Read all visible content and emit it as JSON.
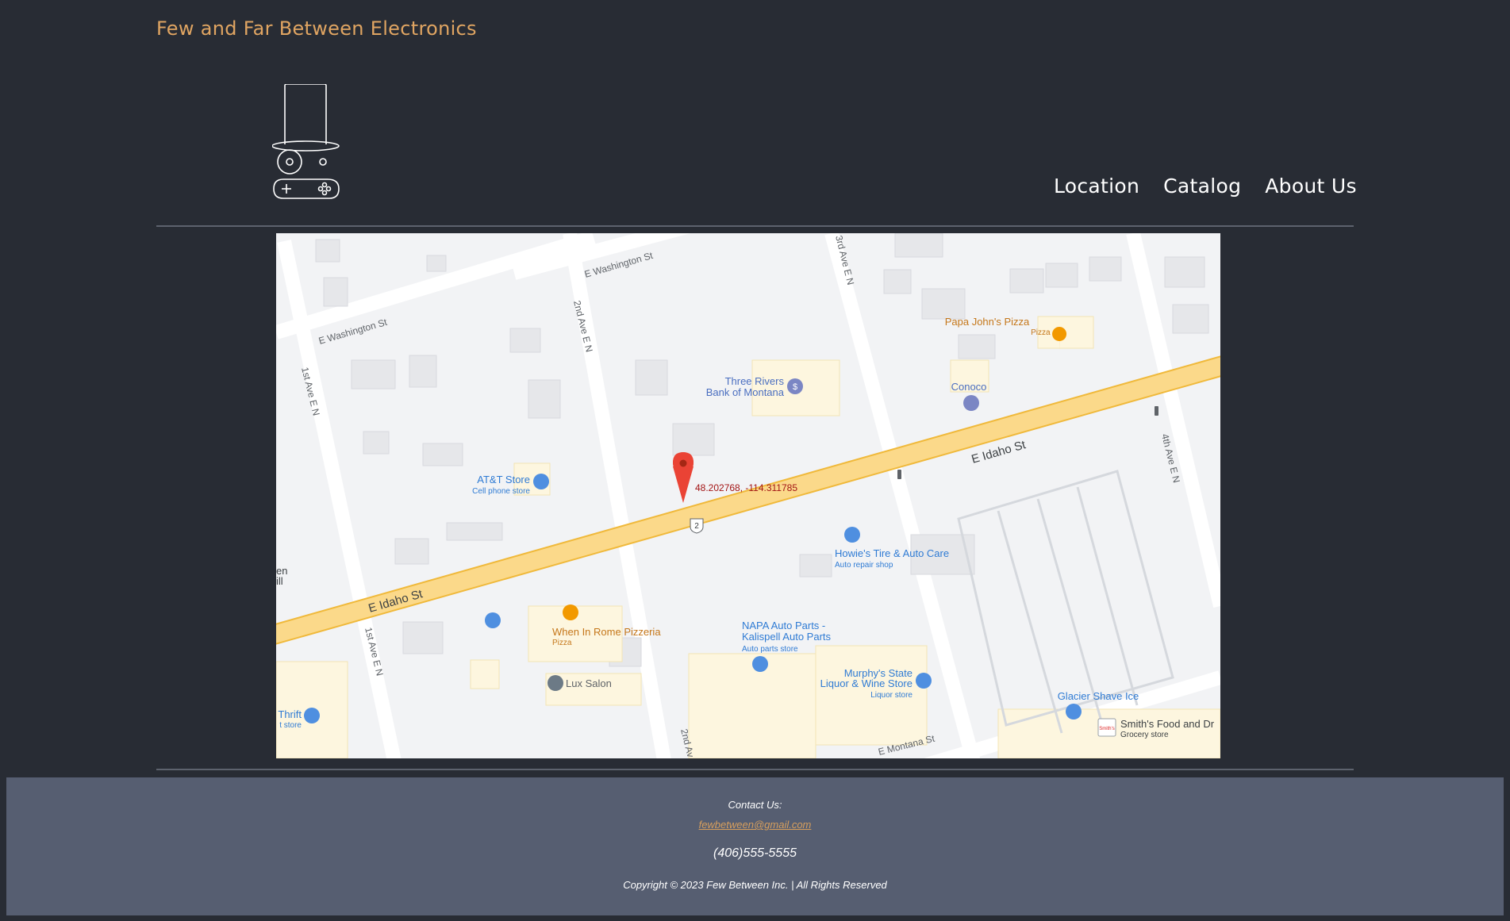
{
  "brand": {
    "name": "Few and Far Between Electronics"
  },
  "logo": {
    "icon": "top-hat-robot-gamepad-icon"
  },
  "nav": {
    "items": [
      {
        "label": "Location"
      },
      {
        "label": "Catalog"
      },
      {
        "label": "About Us"
      }
    ]
  },
  "map": {
    "pin_label": "48.202768, -114.311785",
    "route_shield": "2",
    "streets": {
      "e_washington_1": "E Washington St",
      "e_washington_2": "E Washington St",
      "ave2": "2nd Ave E N",
      "ave3": "3rd Ave E N",
      "ave1": "1st Ave E N",
      "ave1b": "1st Ave E N",
      "ave4": "4th Ave E N",
      "e_idaho_1": "E Idaho St",
      "e_idaho_2": "E Idaho St",
      "ave2b": "2nd Av",
      "e_montana": "E Montana St"
    },
    "places": {
      "papa_johns": {
        "name": "Papa John's Pizza",
        "sub": "Pizza · $"
      },
      "three_rivers": {
        "line1": "Three Rivers",
        "line2": "Bank of Montana"
      },
      "conoco": {
        "name": "Conoco"
      },
      "att": {
        "name": "AT&T Store",
        "sub": "Cell phone store"
      },
      "howies": {
        "name": "Howie's Tire & Auto Care",
        "sub": "Auto repair shop"
      },
      "napa": {
        "line1": "NAPA Auto Parts -",
        "line2": "Kalispell Auto Parts",
        "sub": "Auto parts store"
      },
      "when_in_rome": {
        "name": "When In Rome Pizzeria",
        "sub": "Pizza"
      },
      "lux": {
        "name": "Lux Salon"
      },
      "murphys": {
        "line1": "Murphy's State",
        "line2": "Liquor & Wine Store",
        "sub": "Liquor store"
      },
      "glacier": {
        "name": "Glacier Shave Ice"
      },
      "smiths": {
        "name": "Smith's Food and Dr",
        "sub": "Grocery store",
        "logo_text": "Smith's"
      },
      "thrift": {
        "name": "Thrift",
        "sub": "t store"
      },
      "left_edge": {
        "line1": "en",
        "line2": "ill"
      }
    }
  },
  "footer": {
    "contact_label": "Contact Us:",
    "email": "fewbetween@gmail.com",
    "phone": "(406)555-5555",
    "copyright": "Copyright © 2023 Few Between Inc. | All Rights Reserved"
  },
  "colors": {
    "background": "#282c34",
    "brand": "#e0a562",
    "footer_bg": "#565e71",
    "map_road_major": "#fbd98a",
    "map_pin": "#ea4335"
  }
}
